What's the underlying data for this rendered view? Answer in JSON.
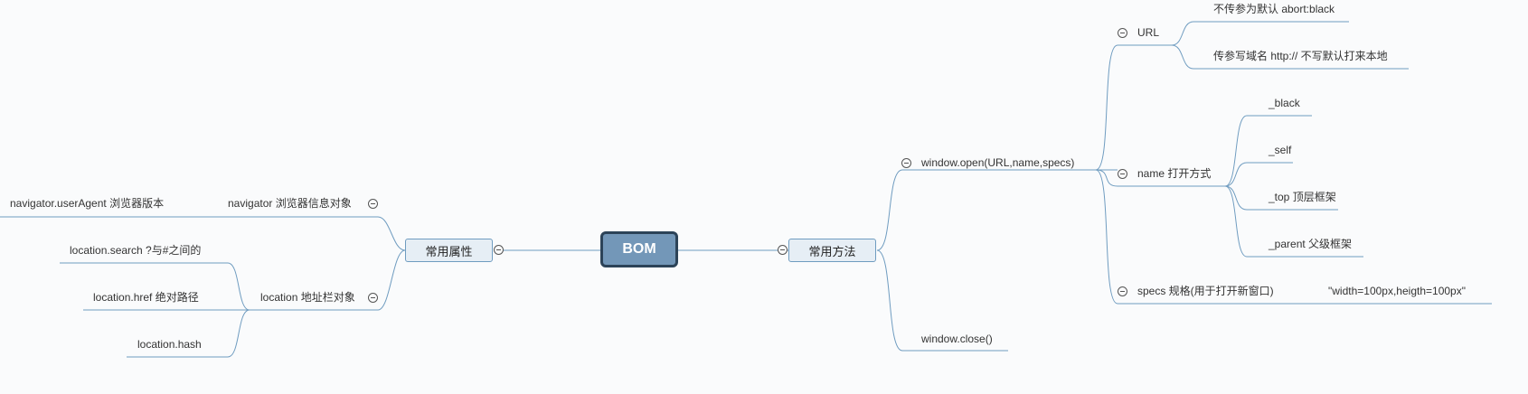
{
  "root": {
    "label": "BOM"
  },
  "left_main": {
    "label": "常用属性"
  },
  "right_main": {
    "label": "常用方法"
  },
  "navigator": {
    "label": "navigator  浏览器信息对象",
    "child": "navigator.userAgent 浏览器版本"
  },
  "location": {
    "label": "location 地址栏对象",
    "children": [
      "location.search ?与#之间的",
      "location.href 绝对路径",
      "location.hash"
    ]
  },
  "window_open": {
    "label": "window.open(URL,name,specs)"
  },
  "window_close": {
    "label": "window.close()"
  },
  "url": {
    "label": "URL",
    "children": [
      "不传参为默认 abort:black",
      "传参写域名 http://  不写默认打来本地"
    ]
  },
  "name": {
    "label": "name 打开方式",
    "children": [
      "_black",
      "_self",
      "_top 顶层框架",
      "_parent 父级框架"
    ]
  },
  "specs": {
    "label": "specs 规格(用于打开新窗口)",
    "value": "\"width=100px,heigth=100px\""
  },
  "colors": {
    "line": "#6f9cc0",
    "root_fill": "#7397b8",
    "root_border": "#2c4358",
    "branch_fill": "#e6eef5"
  }
}
